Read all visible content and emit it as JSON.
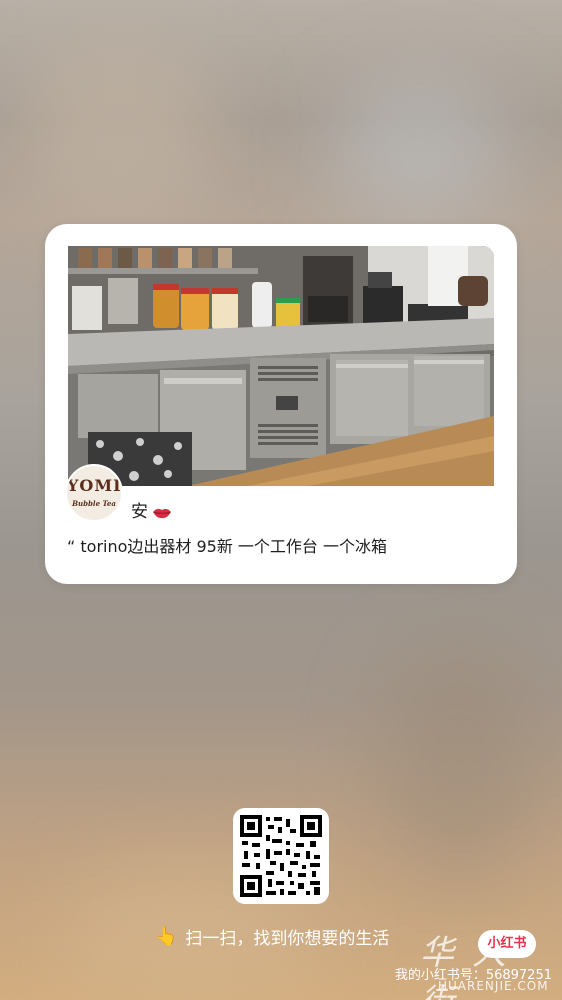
{
  "post": {
    "author_name": "安",
    "author_emoji_icon": "lips-icon",
    "caption": "“ torino边出器材 95新 一个工作台 一个冰箱",
    "avatar": {
      "brand_text": "YOMI",
      "sub_text": "Bubble Tea"
    }
  },
  "share": {
    "scan_hint": "扫一扫，找到你想要的生活",
    "hand_icon": "pointing-hand-icon",
    "qr_icon": "qr-code-icon"
  },
  "footer": {
    "app_badge": "小红书",
    "user_id_text": "我的小红书号：56897251",
    "watermark_cn": "华人街",
    "watermark_en": "HUARENJIE.COM"
  },
  "colors": {
    "badge_red": "#e8324a",
    "card_bg": "#ffffff"
  }
}
